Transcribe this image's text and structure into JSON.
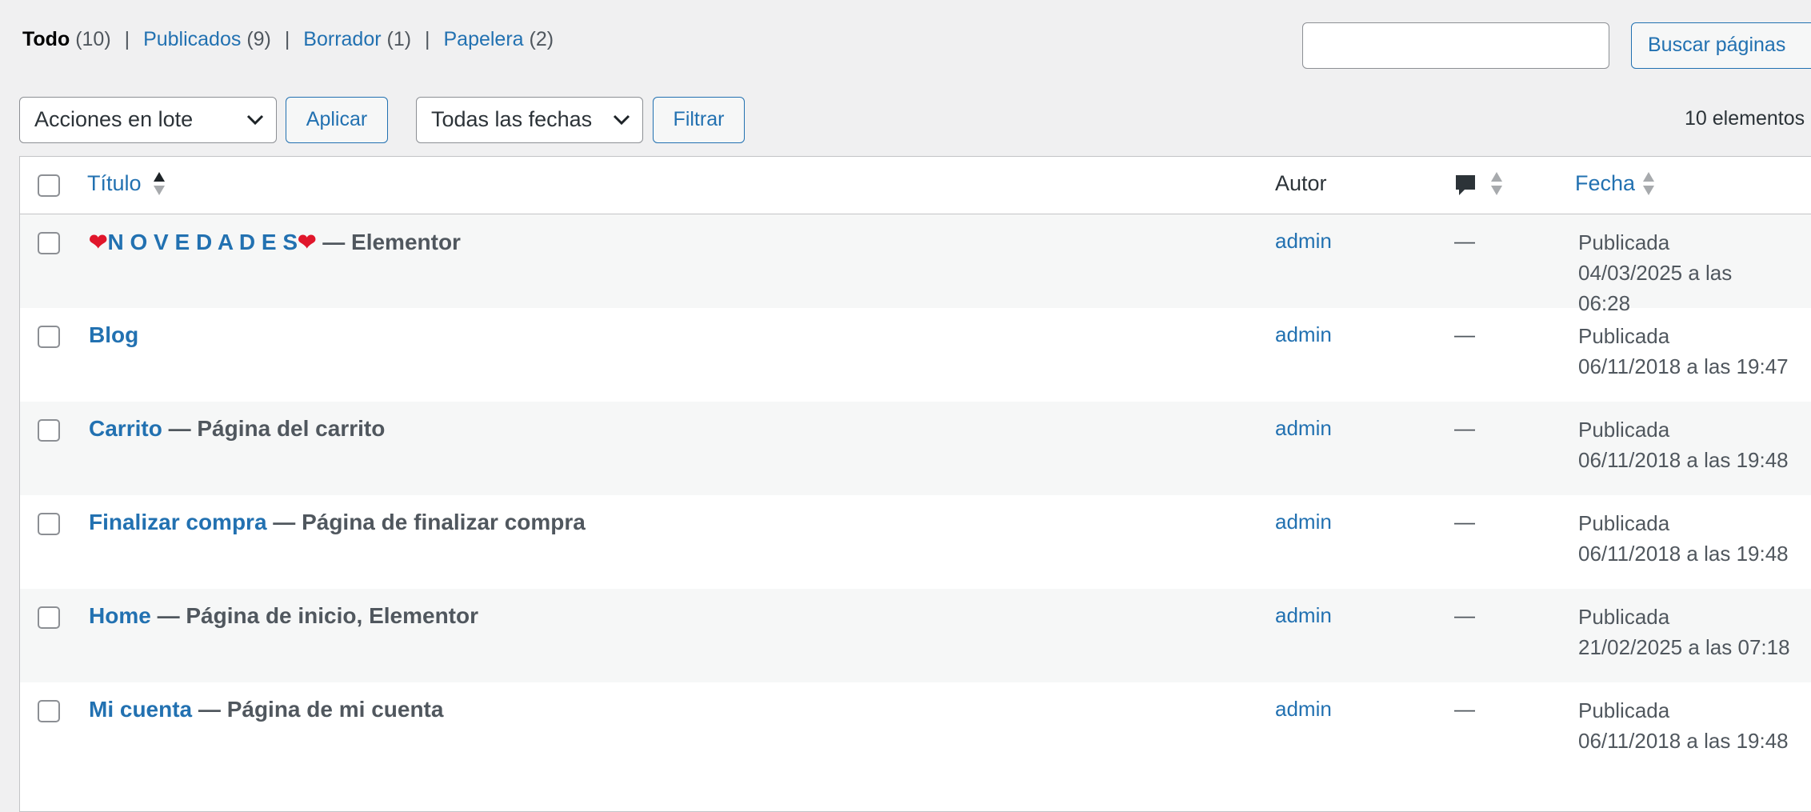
{
  "filters": {
    "all_label": "Todo",
    "all_count": "(10)",
    "published_label": "Publicados",
    "published_count": "(9)",
    "draft_label": "Borrador",
    "draft_count": "(1)",
    "trash_label": "Papelera",
    "trash_count": "(2)",
    "separator": "|"
  },
  "search": {
    "value": "",
    "button_label": "Buscar páginas"
  },
  "toolbar": {
    "bulk_actions_selected": "Acciones en lote",
    "apply_label": "Aplicar",
    "dates_selected": "Todas las fechas",
    "filter_label": "Filtrar",
    "items_count": "10 elementos"
  },
  "table": {
    "columns": {
      "title": "Título",
      "author": "Autor",
      "comments_icon": "comment-bubble-icon",
      "date": "Fecha"
    },
    "rows": [
      {
        "title": "N O V E D A D E S",
        "title_prefix": "❤",
        "title_suffix": "❤",
        "state": " — Elementor",
        "author": "admin",
        "comments": "—",
        "date_status": "Publicada",
        "date_line1": "04/03/2025 a las",
        "date_line2": "06:28"
      },
      {
        "title": "Blog",
        "state": "",
        "author": "admin",
        "comments": "—",
        "date_status": "Publicada",
        "date_line1": "06/11/2018 a las 19:47",
        "date_line2": ""
      },
      {
        "title": "Carrito",
        "state": " — Página del carrito",
        "author": "admin",
        "comments": "—",
        "date_status": "Publicada",
        "date_line1": "06/11/2018 a las 19:48",
        "date_line2": ""
      },
      {
        "title": "Finalizar compra",
        "state": " — Página de finalizar compra",
        "author": "admin",
        "comments": "—",
        "date_status": "Publicada",
        "date_line1": "06/11/2018 a las 19:48",
        "date_line2": ""
      },
      {
        "title": "Home",
        "state": " — Página de inicio, Elementor",
        "author": "admin",
        "comments": "—",
        "date_status": "Publicada",
        "date_line1": "21/02/2025 a las 07:18",
        "date_line2": ""
      },
      {
        "title": "Mi cuenta",
        "state": " — Página de mi cuenta",
        "author": "admin",
        "comments": "—",
        "date_status": "Publicada",
        "date_line1": "06/11/2018 a las 19:48",
        "date_line2": ""
      }
    ]
  },
  "colors": {
    "link": "#2271b1",
    "background": "#f0f0f1",
    "heart": "#e0162b"
  }
}
